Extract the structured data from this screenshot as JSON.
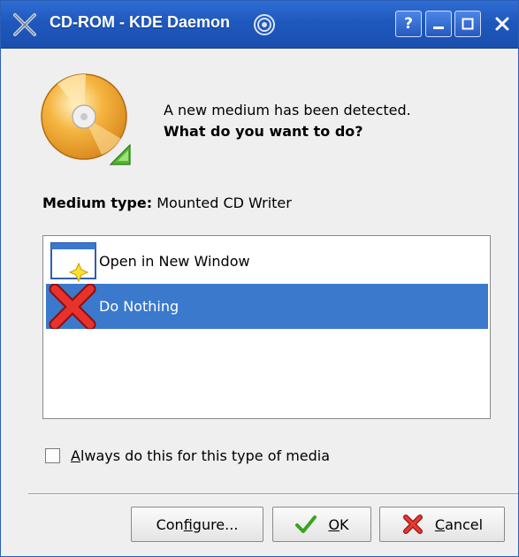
{
  "window": {
    "title": "CD-ROM - KDE Daemon",
    "controls": {
      "help": "?",
      "minimize": "_",
      "maximize": "□",
      "close": "×"
    }
  },
  "message": {
    "line1": "A new medium has been detected.",
    "line2": "What do you want to do?"
  },
  "medium": {
    "label": "Medium type:",
    "value": "Mounted CD Writer"
  },
  "actions": [
    {
      "label": "Open in New Window",
      "icon": "new-window-icon",
      "selected": false
    },
    {
      "label": "Do Nothing",
      "icon": "red-x-icon",
      "selected": true
    }
  ],
  "checkbox": {
    "label_prefix": "A",
    "label_rest": "lways do this for this type of media",
    "checked": false
  },
  "buttons": {
    "configure": {
      "pre": "Con",
      "u": "f",
      "post": "igure..."
    },
    "ok": {
      "pre": "",
      "u": "O",
      "post": "K"
    },
    "cancel": {
      "pre": "",
      "u": "C",
      "post": "ancel"
    }
  },
  "colors": {
    "titlebar": "#1f58bd",
    "selection": "#3a79cc",
    "dialog_bg": "#efefef"
  }
}
